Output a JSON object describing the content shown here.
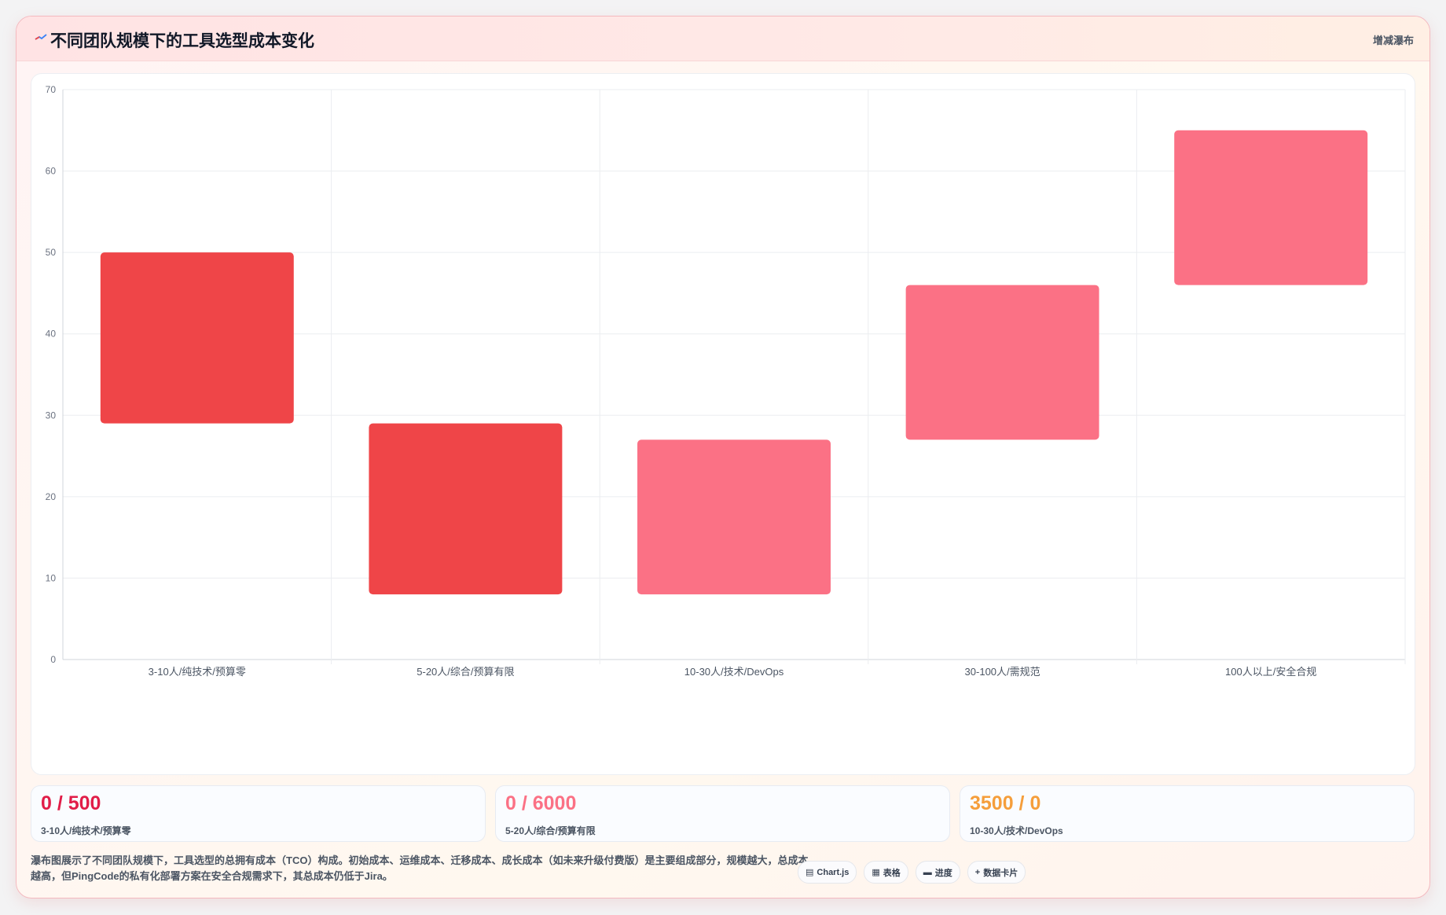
{
  "header": {
    "title": "不同团队规模下的工具选型成本变化",
    "tag": "增减瀑布"
  },
  "chart_data": {
    "type": "bar",
    "subtype": "floating-waterfall",
    "categories": [
      "3-10人/纯技术/预算零",
      "5-20人/综合/预算有限",
      "10-30人/技术/DevOps",
      "30-100人/需规范",
      "100人以上/安全合规"
    ],
    "ranges": [
      [
        29,
        50
      ],
      [
        8,
        29
      ],
      [
        8,
        27
      ],
      [
        27,
        46
      ],
      [
        46,
        65
      ]
    ],
    "colors": [
      "#ef4548",
      "#ef4548",
      "#fb7185",
      "#fb7185",
      "#fb7185"
    ],
    "ylim": [
      0,
      70
    ],
    "yticks": [
      0,
      10,
      20,
      30,
      40,
      50,
      60,
      70
    ],
    "grid": true,
    "title": "",
    "xlabel": "",
    "ylabel": ""
  },
  "stats": [
    {
      "value": "0 / 500",
      "label": "3-10人/纯技术/预算零",
      "color": "#e11d48"
    },
    {
      "value": "0 / 6000",
      "label": "5-20人/综合/预算有限",
      "color": "#fb7185"
    },
    {
      "value": "3500 / 0",
      "label": "10-30人/技术/DevOps",
      "color": "#f59e3b"
    }
  ],
  "note": "瀑布图展示了不同团队规模下，工具选型的总拥有成本（TCO）构成。初始成本、运维成本、迁移成本、成长成本（如未来升级付费版）是主要组成部分，规模越大，总成本越高，但PingCode的私有化部署方案在安全合规需求下，其总成本仍低于Jira。",
  "chips": [
    {
      "label": "Chart.js",
      "icon": "chart-icon"
    },
    {
      "label": "表格",
      "icon": "table-icon"
    },
    {
      "label": "进度",
      "icon": "progress-icon"
    },
    {
      "label": "数据卡片",
      "icon": "plus-icon"
    }
  ]
}
